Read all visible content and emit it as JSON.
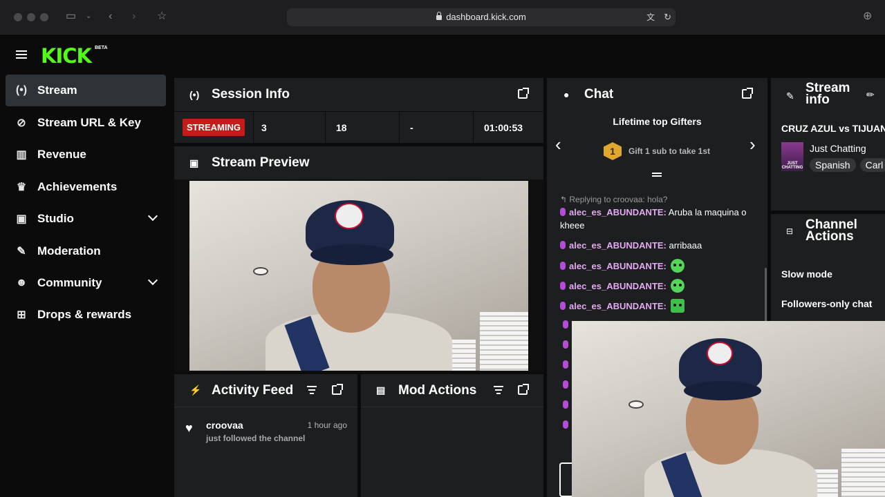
{
  "browser": {
    "url": "dashboard.kick.com"
  },
  "app": {
    "logo": "KICK",
    "beta": "BETA"
  },
  "sidebar": {
    "items": [
      {
        "label": "Stream",
        "icon": "broadcast-icon",
        "active": true
      },
      {
        "label": "Stream URL & Key",
        "icon": "link-icon"
      },
      {
        "label": "Revenue",
        "icon": "bar-chart-icon"
      },
      {
        "label": "Achievements",
        "icon": "trophy-icon"
      },
      {
        "label": "Studio",
        "icon": "studio-icon",
        "expandable": true
      },
      {
        "label": "Moderation",
        "icon": "wrench-icon"
      },
      {
        "label": "Community",
        "icon": "users-icon",
        "expandable": true
      },
      {
        "label": "Drops & rewards",
        "icon": "gift-icon"
      }
    ]
  },
  "session": {
    "title": "Session Info",
    "status": "STREAMING",
    "viewers": "3",
    "followers": "18",
    "subs": "-",
    "duration": "01:00:53"
  },
  "preview": {
    "title": "Stream Preview"
  },
  "activity": {
    "title": "Activity Feed",
    "items": [
      {
        "user": "croovaa",
        "time": "1 hour ago",
        "text": "just followed the channel"
      }
    ]
  },
  "mod_actions": {
    "title": "Mod Actions"
  },
  "chat": {
    "title": "Chat",
    "gifters_title": "Lifetime top Gifters",
    "gifters_rank": "1",
    "gifters_cta": "Gift 1 sub to take 1st",
    "reply_hint": "Replying to croovaa: hola?",
    "messages": [
      {
        "user": "alec_es_ABUNDANTE:",
        "text": " Aruba la maquina o kheee"
      },
      {
        "user": "alec_es_ABUNDANTE:",
        "text": " arribaaa"
      },
      {
        "user": "alec_es_ABUNDANTE:",
        "text": ""
      },
      {
        "user": "alec_es_ABUNDANTE:",
        "text": ""
      },
      {
        "user": "alec_es_ABUNDANTE:",
        "text": ""
      }
    ]
  },
  "stream_info": {
    "title": "Stream info",
    "stream_title": "CRUZ AZUL vs TIJUANA",
    "category": "Just Chatting",
    "category_thumb": "JUST CHATTING",
    "tags": [
      "Spanish",
      "Carl"
    ]
  },
  "channel_actions": {
    "title": "Channel Actions",
    "items": [
      "Slow mode",
      "Followers-only chat"
    ]
  }
}
